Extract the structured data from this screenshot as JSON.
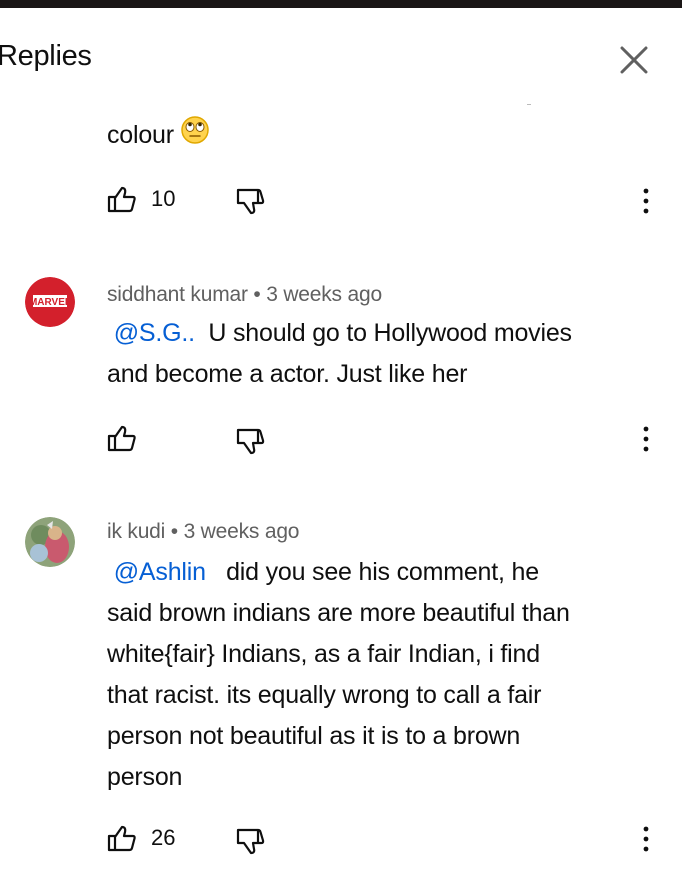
{
  "header": {
    "title": "Replies"
  },
  "replies": [
    {
      "text": "colour",
      "emoji": "rolling-eyes-face",
      "likes": "10"
    },
    {
      "author": "siddhant kumar",
      "separator": "•",
      "time": "3 weeks ago",
      "avatar_text": "MARVEL",
      "mention": "@S.G..",
      "line1": "U should go to Hollywood movies",
      "line2": "and become a actor. Just like her",
      "likes": ""
    },
    {
      "author": "ik kudi",
      "separator": "•",
      "time": "3 weeks ago",
      "mention": "@Ashlin",
      "line1": "did you see his comment, he",
      "line2": "said brown indians are more beautiful than",
      "line3": "white{fair} Indians, as a fair Indian, i find",
      "line4": "that racist. its equally wrong to call a fair",
      "line5": "person not beautiful as it is to a brown",
      "line6": "person",
      "likes": "26"
    }
  ],
  "colors": {
    "mention": "#065fd4",
    "meta": "#606060",
    "text": "#0f0f0f",
    "marvel_red": "#d3202c"
  }
}
